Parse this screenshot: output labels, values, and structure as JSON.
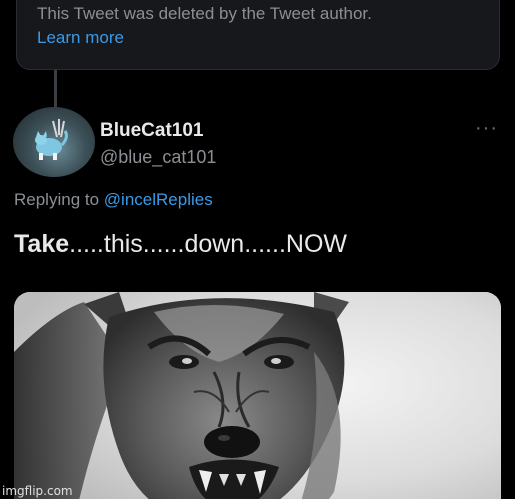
{
  "deleted_tweet": {
    "notice": "This Tweet was deleted by the Tweet author.",
    "learn_more": "Learn more"
  },
  "reply": {
    "display_name": "BlueCat101",
    "handle": "@blue_cat101",
    "replying_prefix": "Replying to ",
    "replying_to": "@incelReplies",
    "text_bold": "Take",
    "text_rest": ".....this......down......NOW",
    "more_icon": "···"
  },
  "watermark": "imgflip.com",
  "colors": {
    "background": "#000000",
    "link": "#3b9ae8",
    "muted": "#8b8f95",
    "text": "#e7e9ea"
  }
}
